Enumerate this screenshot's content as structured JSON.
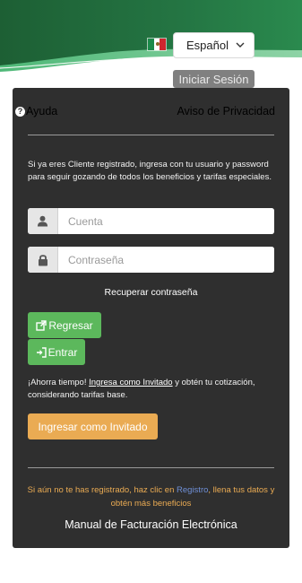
{
  "header": {
    "language_selected": "Español",
    "login_tab_label": "Iniciar Sesión"
  },
  "card": {
    "help_label": "Ayuda",
    "privacy_label": "Aviso de Privacidad",
    "intro_text": "Si ya eres Cliente registrado, ingresa con tu usuario y password para seguir gozando de todos los beneficios y tarifas especiales.",
    "username_placeholder": "Cuenta",
    "password_placeholder": "Contraseña",
    "recover_label": "Recuperar contraseña",
    "back_button_label": "Regresar",
    "enter_button_label": "Entrar",
    "save_prefix": "¡Ahorra tiempo! ",
    "save_link": "Ingresa como Invitado",
    "save_suffix": " y obtén tu cotización, considerando tarifas base.",
    "guest_button_label": "Ingresar como Invitado",
    "register_prefix": "Si aún no te has registrado, haz clic en ",
    "register_link": "Registro",
    "register_suffix": ", llena tus datos y obtén más beneficios",
    "manual_label": "Manual de Facturación Electrónica"
  },
  "icons": {
    "help": "question-circle-icon",
    "user": "user-icon",
    "lock": "lock-icon",
    "external": "external-link-icon",
    "signin": "sign-in-icon",
    "flag": "mexico-flag-icon",
    "chevron": "chevron-down-icon"
  },
  "colors": {
    "banner_dark_green": "#1f6b3a",
    "card_bg": "#2f2f2f",
    "button_green": "#5cb85c",
    "button_orange": "#eaab53",
    "link_blue": "#6f8fd6"
  }
}
